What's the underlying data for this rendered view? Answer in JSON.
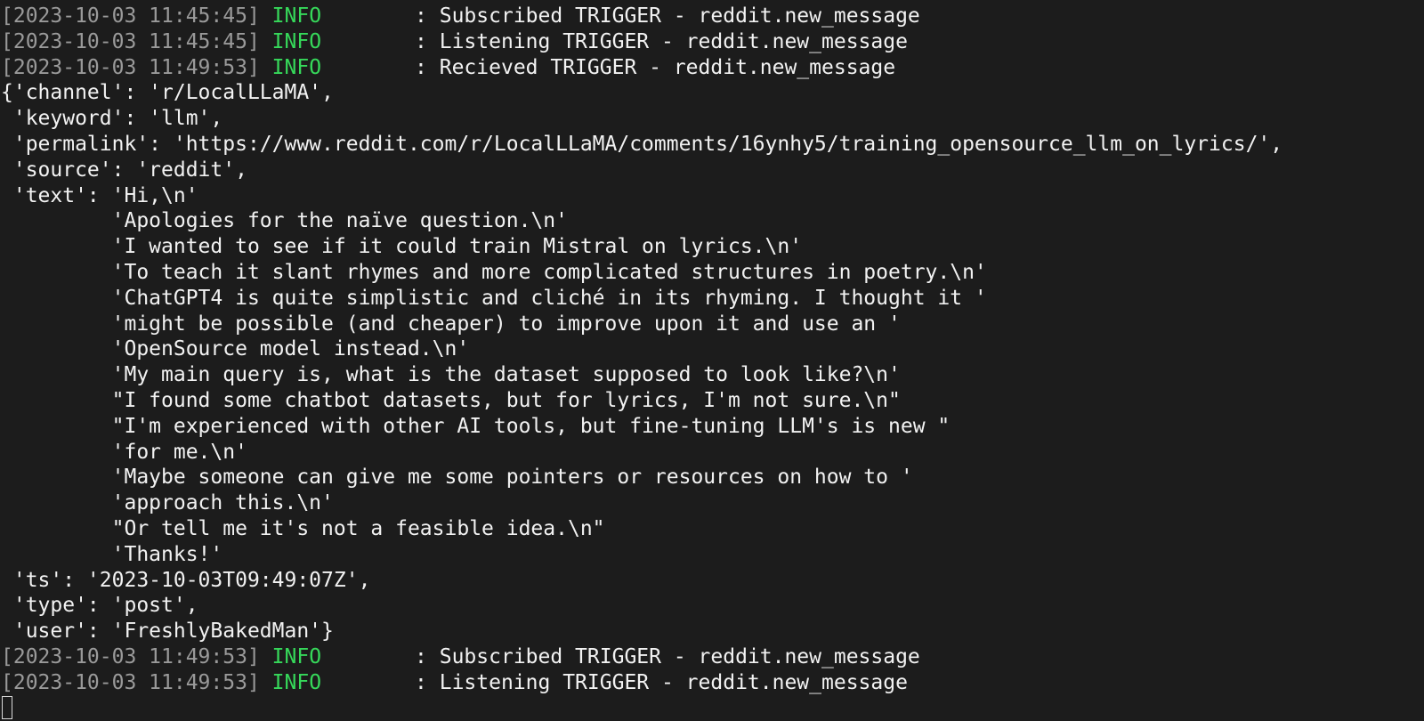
{
  "log_lines_top": [
    {
      "timestamp": "[2023-10-03 11:45:45]",
      "level": "INFO",
      "message": ": Subscribed TRIGGER - reddit.new_message"
    },
    {
      "timestamp": "[2023-10-03 11:45:45]",
      "level": "INFO",
      "message": ": Listening TRIGGER - reddit.new_message"
    },
    {
      "timestamp": "[2023-10-03 11:49:53]",
      "level": "INFO",
      "message": ": Recieved TRIGGER - reddit.new_message"
    }
  ],
  "payload_lines": [
    "{'channel': 'r/LocalLLaMA',",
    " 'keyword': 'llm',",
    " 'permalink': 'https://www.reddit.com/r/LocalLLaMA/comments/16ynhy5/training_opensource_llm_on_lyrics/',",
    " 'source': 'reddit',",
    " 'text': 'Hi,\\n'",
    "         'Apologies for the naïve question.\\n'",
    "         'I wanted to see if it could train Mistral on lyrics.\\n'",
    "         'To teach it slant rhymes and more complicated structures in poetry.\\n'",
    "         'ChatGPT4 is quite simplistic and cliché in its rhyming. I thought it '",
    "         'might be possible (and cheaper) to improve upon it and use an '",
    "         'OpenSource model instead.\\n'",
    "         'My main query is, what is the dataset supposed to look like?\\n'",
    "         \"I found some chatbot datasets, but for lyrics, I'm not sure.\\n\"",
    "         \"I'm experienced with other AI tools, but fine-tuning LLM's is new \"",
    "         'for me.\\n'",
    "         'Maybe someone can give me some pointers or resources on how to '",
    "         'approach this.\\n'",
    "         \"Or tell me it's not a feasible idea.\\n\"",
    "         'Thanks!'",
    " 'ts': '2023-10-03T09:49:07Z',",
    " 'type': 'post',",
    " 'user': 'FreshlyBakedMan'}"
  ],
  "log_lines_bottom": [
    {
      "timestamp": "[2023-10-03 11:49:53]",
      "level": "INFO",
      "message": ": Subscribed TRIGGER - reddit.new_message"
    },
    {
      "timestamp": "[2023-10-03 11:49:53]",
      "level": "INFO",
      "message": ": Listening TRIGGER - reddit.new_message"
    }
  ],
  "colors": {
    "background": "#1c1c1c",
    "text": "#f2f2f2",
    "timestamp": "#9a9a9a",
    "info_level": "#36d85a"
  }
}
